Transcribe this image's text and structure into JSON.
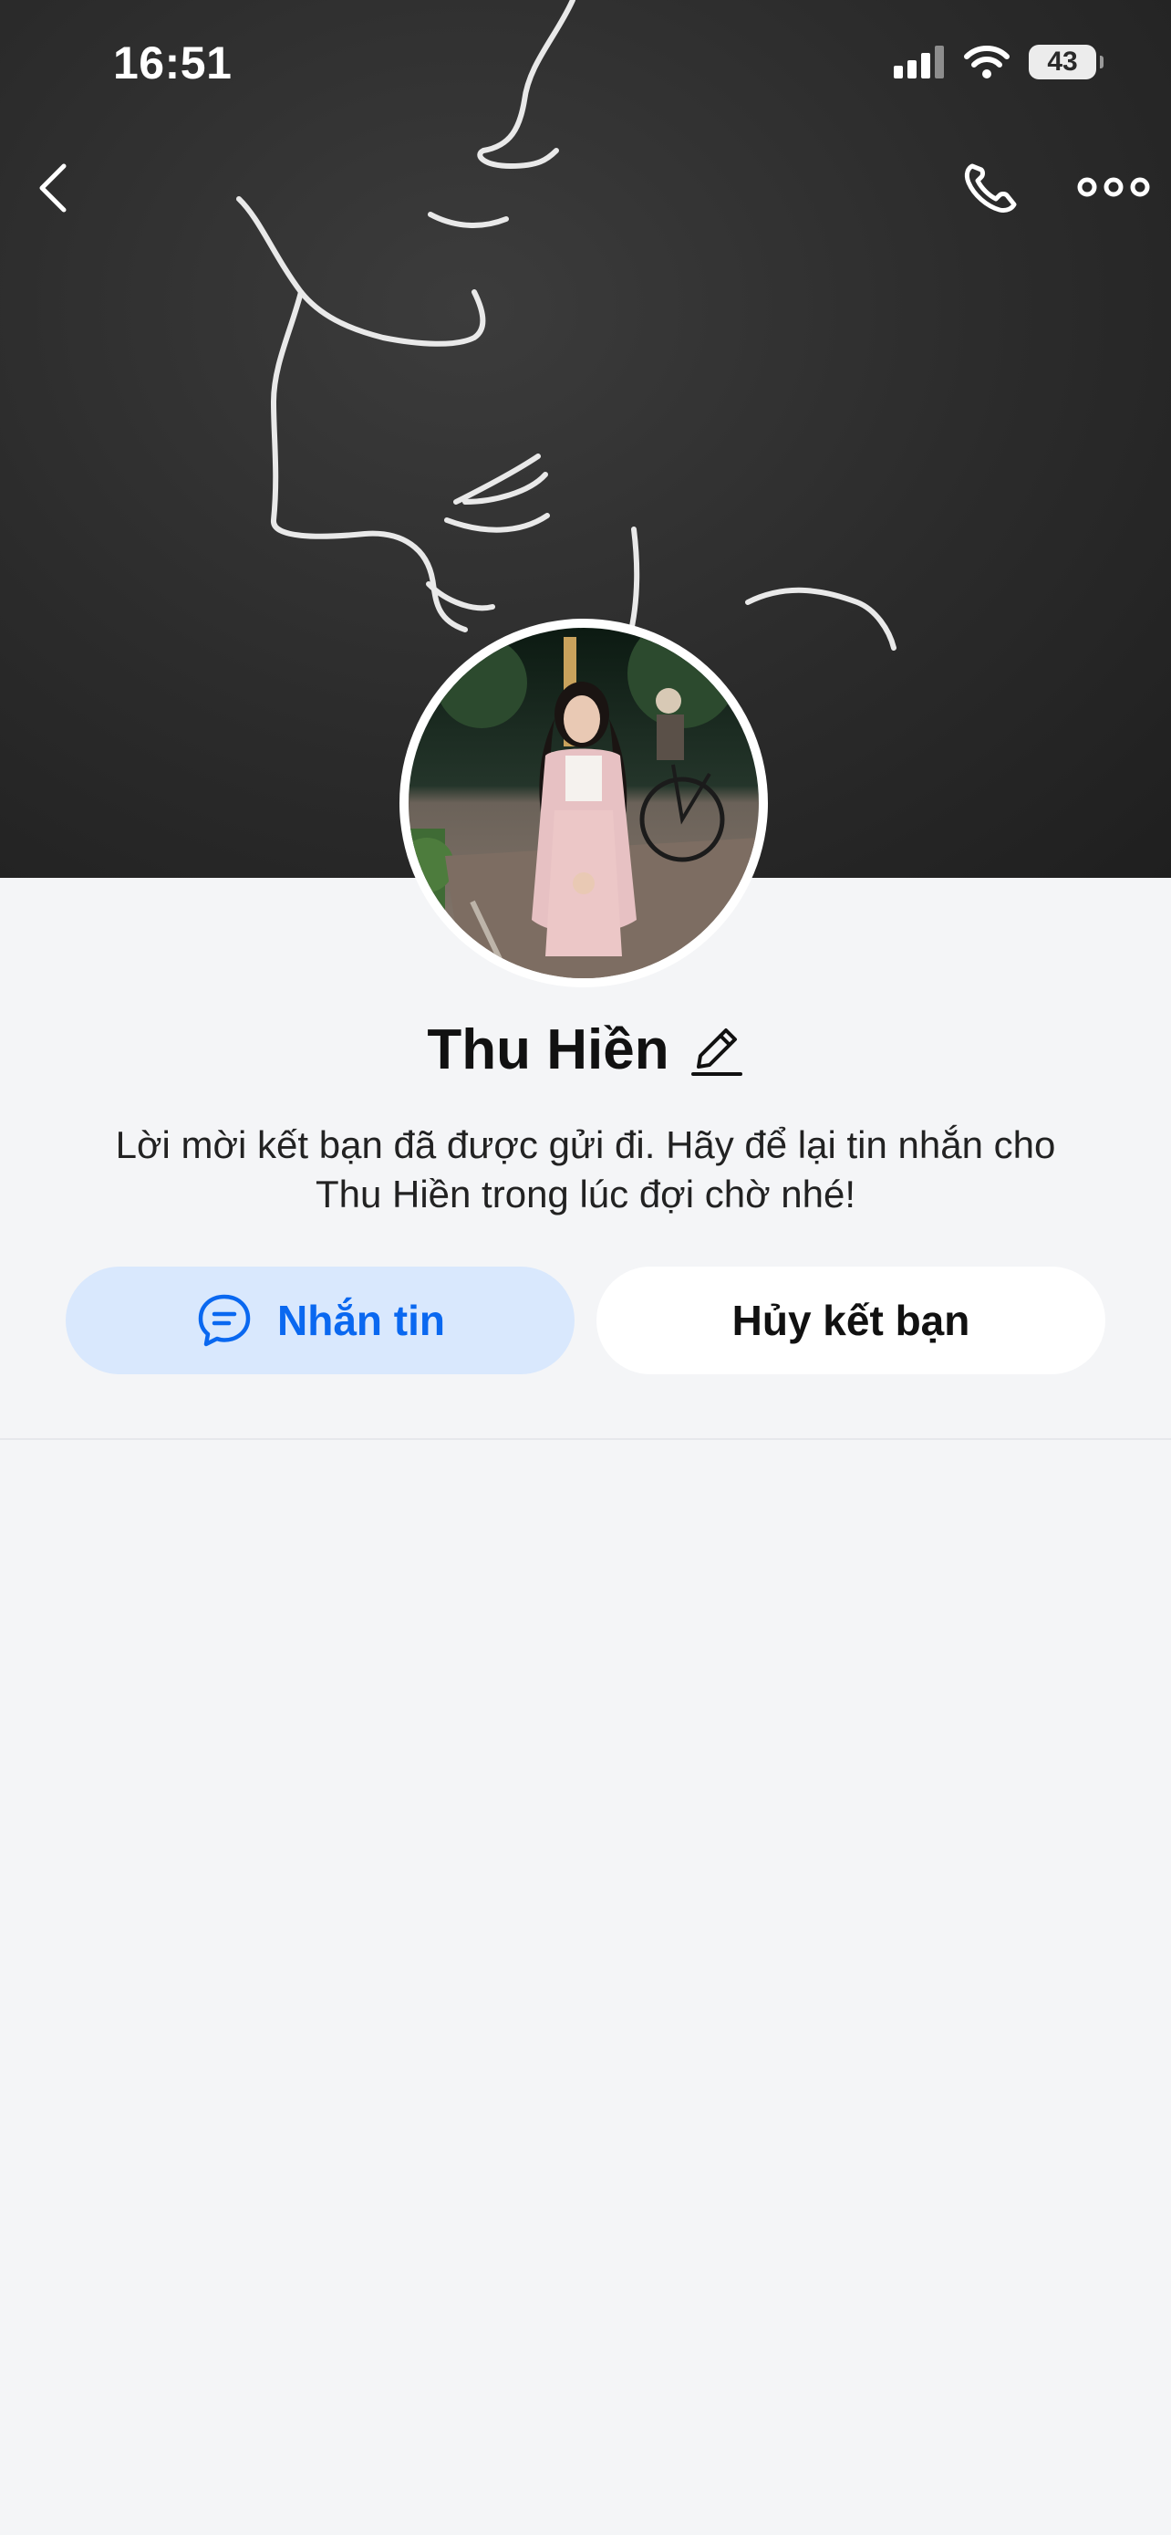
{
  "status_bar": {
    "time": "16:51",
    "battery": "43"
  },
  "nav": {
    "back_icon": "chevron-left-icon",
    "call_icon": "phone-icon",
    "more_icon": "more-dots-icon"
  },
  "profile": {
    "name": "Thu Hiền",
    "message_line1": "Lời mời kết bạn đã được gửi đi. Hãy để lại tin nhắn cho",
    "message_line2": "Thu Hiền trong lúc đợi chờ nhé!"
  },
  "actions": {
    "message_label": "Nhắn tin",
    "cancel_label": "Hủy kết bạn"
  },
  "colors": {
    "accent": "#0a68f0",
    "message_button_bg": "#d9e8fd",
    "page_bg": "#f4f5f7"
  }
}
